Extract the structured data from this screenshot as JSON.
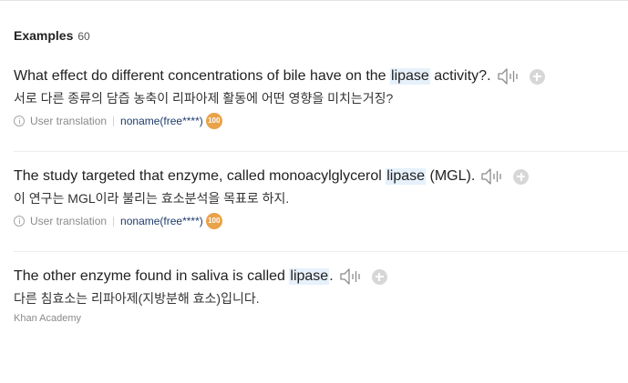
{
  "header": {
    "title": "Examples",
    "count": "60"
  },
  "examples": [
    {
      "en_before": "What effect do different concentrations of bile have on the",
      "en_highlight": "lipase",
      "en_after": "activity?.",
      "ko": "서로 다른 종류의 담즙 농축이 리파아제 활동에 어떤 영향을 미치는거징?",
      "meta_label": "User translation",
      "meta_user": "noname(free****)",
      "badge": "100"
    },
    {
      "en_before": "The study targeted that enzyme, called monoacylglycerol",
      "en_highlight": "lipase",
      "en_after": "(MGL).",
      "ko": "이 연구는 MGL이라 불리는 효소분석을 목표로 하지.",
      "meta_label": "User translation",
      "meta_user": "noname(free****)",
      "badge": "100"
    },
    {
      "en_before": "The other enzyme found in saliva is called",
      "en_highlight": "lipase",
      "en_after": ".",
      "ko": "다른 침효소는 리파아제(지방분해 효소)입니다.",
      "source": "Khan Academy"
    }
  ],
  "icons": {
    "speaker": "speaker-icon",
    "add": "plus-circle-icon",
    "info": "info-icon"
  },
  "colors": {
    "highlight": "#e6f1fb",
    "badge": "#e9a24a",
    "user_link": "#1d3a6b"
  }
}
